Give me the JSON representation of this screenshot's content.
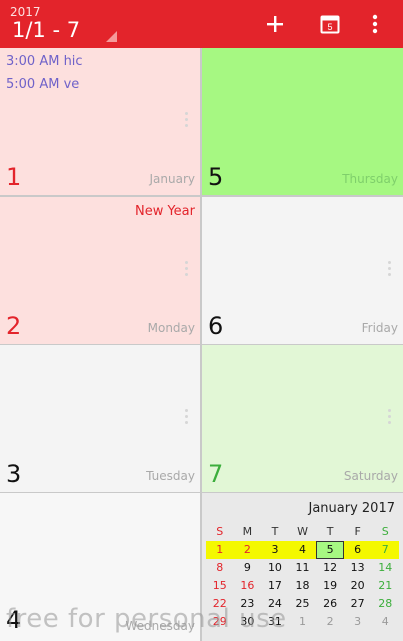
{
  "toolbar": {
    "year": "2017",
    "range": "1/1 - 7",
    "add_icon": "plus-icon",
    "today_icon": "calendar-today-icon",
    "today_num": "5",
    "more_icon": "more-vert-icon",
    "bg_color": "#e3242b"
  },
  "days": {
    "sun": {
      "num": "1",
      "name": "January",
      "events": [
        "3:00 AM hic",
        "5:00 AM ve"
      ]
    },
    "mon": {
      "num": "2",
      "name": "Monday",
      "holiday": "New Year"
    },
    "tue": {
      "num": "3",
      "name": "Tuesday"
    },
    "wed": {
      "num": "4",
      "name": "Wednesday"
    },
    "thu": {
      "num": "5",
      "name": "Thursday"
    },
    "fri": {
      "num": "6",
      "name": "Friday"
    },
    "sat": {
      "num": "7",
      "name": "Saturday"
    }
  },
  "mini_calendar": {
    "title": "January 2017",
    "headers": [
      "S",
      "M",
      "T",
      "W",
      "T",
      "F",
      "S"
    ],
    "weeks": [
      [
        "1",
        "2",
        "3",
        "4",
        "5",
        "6",
        "7"
      ],
      [
        "8",
        "9",
        "10",
        "11",
        "12",
        "13",
        "14"
      ],
      [
        "15",
        "16",
        "17",
        "18",
        "19",
        "20",
        "21"
      ],
      [
        "22",
        "23",
        "24",
        "25",
        "26",
        "27",
        "28"
      ],
      [
        "29",
        "30",
        "31",
        "1",
        "2",
        "3",
        "4"
      ]
    ],
    "highlight_color": "#f4f800",
    "today_color": "#a6f882"
  },
  "watermark": "free for personal use"
}
